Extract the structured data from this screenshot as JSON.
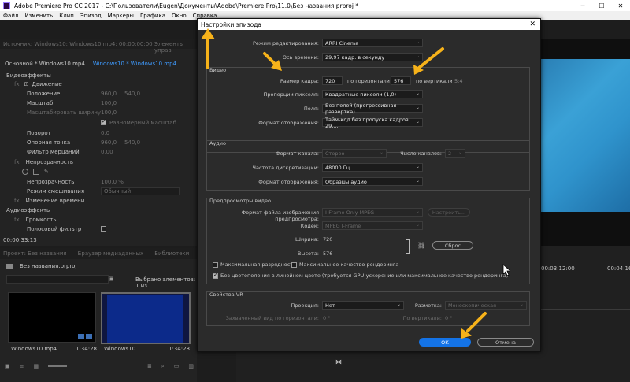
{
  "app": {
    "title": "Adobe Premiere Pro CC 2017 - C:\\Пользователи\\Eugen\\Документы\\Adobe\\Premiere Pro\\11.0\\Без названия.prproj *"
  },
  "menu": [
    "Файл",
    "Изменить",
    "Клип",
    "Эпизод",
    "Маркеры",
    "Графика",
    "Окно",
    "Справка"
  ],
  "source_panel": {
    "header": "Источник: Windows10: Windows10.mp4: 00:00:00:00",
    "header_right": "Элементы управ",
    "tab_main": "Основной * Windows10.mp4",
    "tab_active": "Windows10 * Windows10.mp4",
    "video_effects": "Видеоэффекты",
    "motion": "Движение",
    "position": "Положение",
    "position_x": "960,0",
    "position_y": "540,0",
    "scale": "Масштаб",
    "scale_val": "100,0",
    "scale_width": "Масштабировать ширину",
    "scale_width_val": "100,0",
    "uniform_scale": "Равномерный масштаб",
    "rotation": "Поворот",
    "rotation_val": "0,0",
    "anchor": "Опорная точка",
    "anchor_x": "960,0",
    "anchor_y": "540,0",
    "flicker": "Фильтр мерцаний",
    "flicker_val": "0,00",
    "opacity_group": "Непрозрачность",
    "opacity": "Непрозрачность",
    "opacity_val": "100,0 %",
    "blend_mode": "Режим смешивания",
    "blend_mode_val": "Обычный",
    "time_remap": "Изменение времени",
    "audio_effects": "Аудиоэффекты",
    "volume": "Громкость",
    "band_filter": "Полосовой фильтр",
    "timecode": "00:00:33:13"
  },
  "project_panel": {
    "tab_project": "Проект: Без названия",
    "tab_browser": "Браузер медиаданных",
    "tab_libraries": "Библиотеки",
    "file": "Без названия.prproj",
    "selected": "Выбрано элементов: 1 из",
    "clip1_name": "Windows10.mp4",
    "clip1_dur": "1:34:28",
    "clip2_name": "Windows10",
    "clip2_dur": "1:34:28"
  },
  "timeline": {
    "tc1": "00:03:12:00",
    "tc2": "00:04:16:0"
  },
  "dialog": {
    "title": "Настройки эпизода",
    "close": "✕",
    "edit_mode_label": "Режим редактирования:",
    "edit_mode": "ARRI Cinema",
    "timebase_label": "Ось времени:",
    "timebase": "29,97  кадр. в секунду",
    "video_section": "Видео",
    "frame_size_label": "Размер кадра:",
    "frame_width": "720",
    "horiz_label": "по горизонтали",
    "frame_height": "576",
    "vert_label": "по вертикали",
    "aspect": "5:4",
    "pixel_aspect_label": "Пропорции пикселя:",
    "pixel_aspect": "Квадратные пиксели (1,0)",
    "fields_label": "Поля:",
    "fields": "Без полей (прогрессивная развертка)",
    "display_format_label": "Формат отображения:",
    "display_format": "Тайм-код без пропуска кадров 29,...",
    "audio_section": "Аудио",
    "audio_format_label": "Формат канала:",
    "audio_format": "Стерео",
    "channels_label": "Число каналов:",
    "channels": "2",
    "sample_rate_label": "Частота дискретизации:",
    "sample_rate": "48000 Гц",
    "audio_display_label": "Формат отображения:",
    "audio_display": "Образцы аудио",
    "preview_section": "Предпросмотры видео",
    "preview_format_label": "Формат файла изображения предпросмотра:",
    "preview_format": "I-Frame Only MPEG",
    "configure": "Настроить...",
    "codec_label": "Кодек:",
    "codec": "MPEG I-Frame",
    "width_label": "Ширина:",
    "width": "720",
    "height_label": "Высота:",
    "height": "576",
    "reset": "Сброс",
    "max_depth": "Максимальная разрядность",
    "max_quality": "Максимальное качество рендеринга",
    "linear_color": "Без цветопеления в линейном цвете (требуется GPU-ускорение или максимальное качество рендеринга)",
    "vr_section": "Свойства VR",
    "projection_label": "Проекция:",
    "projection": "Нет",
    "layout_label": "Разметка:",
    "layout": "Моноскопическая",
    "captured_h_label": "Захваченный вид по горизонтали:",
    "captured_h": "0 °",
    "vertical_label": "По вертикали:",
    "vertical": "0 °",
    "ok": "ОК",
    "cancel": "Отмена"
  },
  "colors": {
    "accent": "#1473e6",
    "arrow": "#f6b21a",
    "preview_blue": "#3aa1d6"
  }
}
